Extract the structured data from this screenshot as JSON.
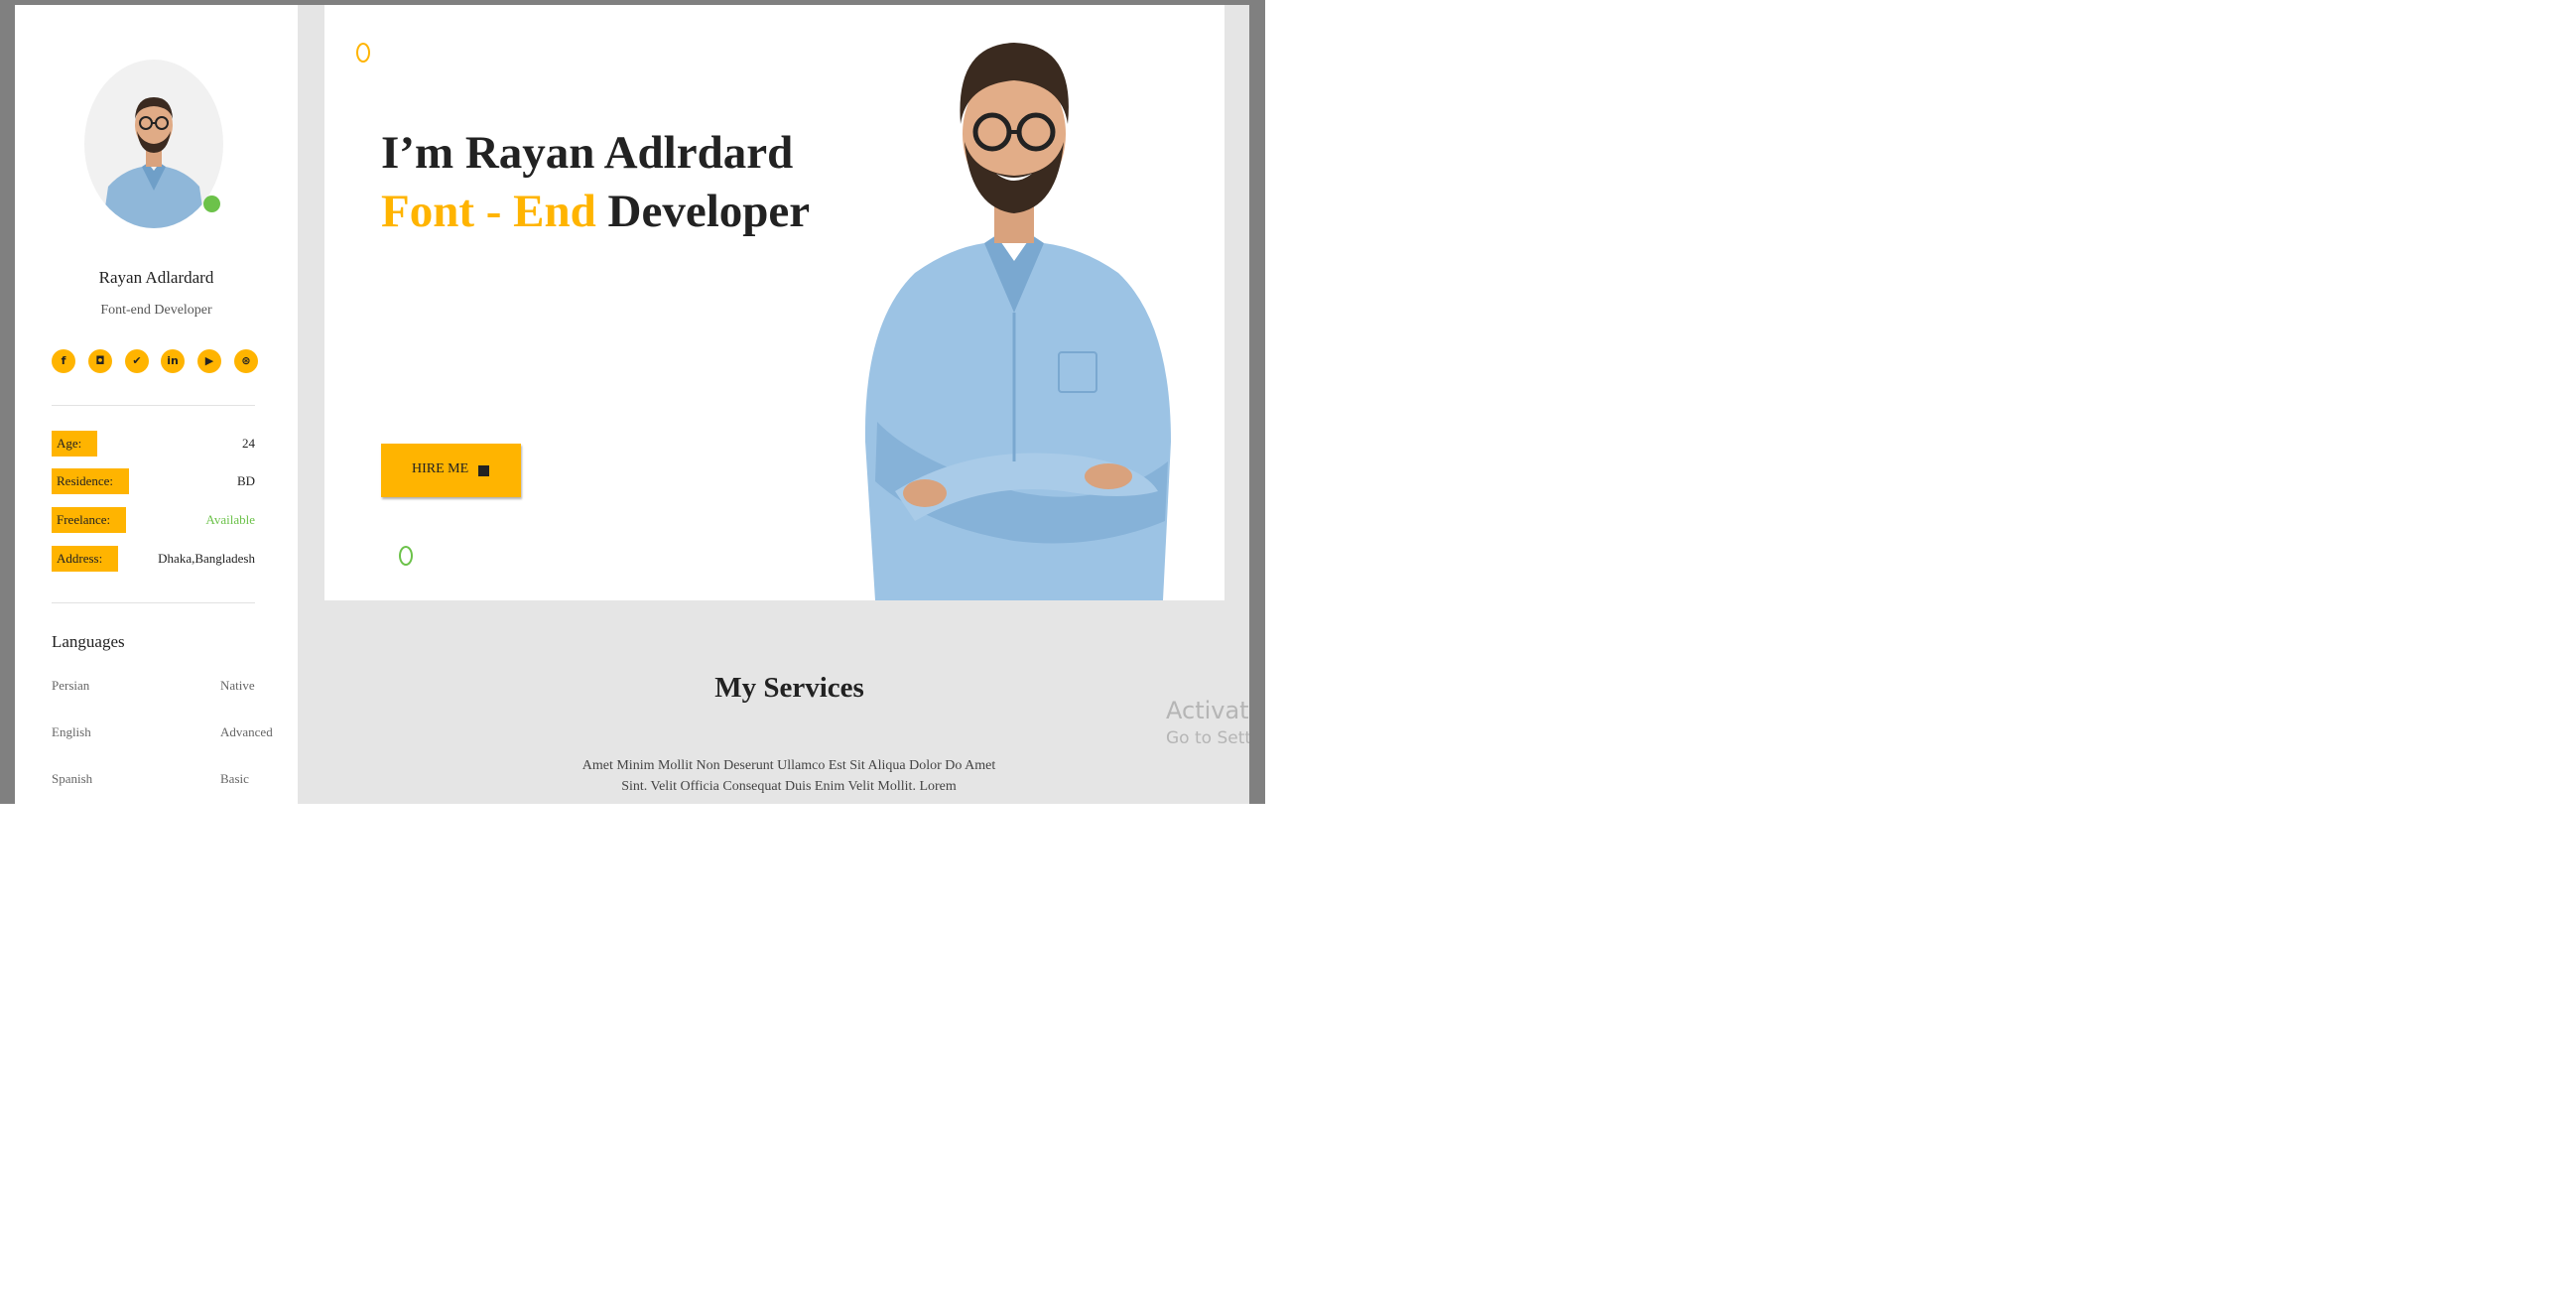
{
  "sidebar": {
    "name": "Rayan Adlardard",
    "role": "Font-end Developer",
    "socials": [
      {
        "icon": "facebook-icon",
        "glyph": "f"
      },
      {
        "icon": "instagram-icon",
        "glyph": "◘"
      },
      {
        "icon": "twitter-icon",
        "glyph": "✔"
      },
      {
        "icon": "linkedin-icon",
        "glyph": "in"
      },
      {
        "icon": "youtube-icon",
        "glyph": "▶"
      },
      {
        "icon": "dribbble-icon",
        "glyph": "⊛"
      }
    ],
    "info": [
      {
        "label": "Age:",
        "value": "24"
      },
      {
        "label": "Residence:",
        "value": "BD"
      },
      {
        "label": "Freelance:",
        "value": "Available"
      },
      {
        "label": "Address:",
        "value": "Dhaka,Bangladesh"
      }
    ],
    "languages_title": "Languages",
    "languages": [
      {
        "name": "Persian",
        "level": "Native"
      },
      {
        "name": "English",
        "level": "Advanced"
      },
      {
        "name": "Spanish",
        "level": "Basic"
      }
    ]
  },
  "hero": {
    "title_line1": "I’m Rayan Adlrdard",
    "title_accent": "Font - End",
    "title_rest": " Developer",
    "hire_label": "HIRE ME"
  },
  "services": {
    "title": "My Services",
    "text": "Amet Minim Mollit Non Deserunt Ullamco Est Sit Aliqua Dolor Do Amet Sint. Velit Officia Consequat Duis Enim Velit Mollit. Lorem"
  },
  "overlay": {
    "activate": "Activate",
    "settings": "Go to Settin"
  },
  "colors": {
    "accent": "#ffb400",
    "online": "#6cc24a",
    "text": "#222222"
  }
}
